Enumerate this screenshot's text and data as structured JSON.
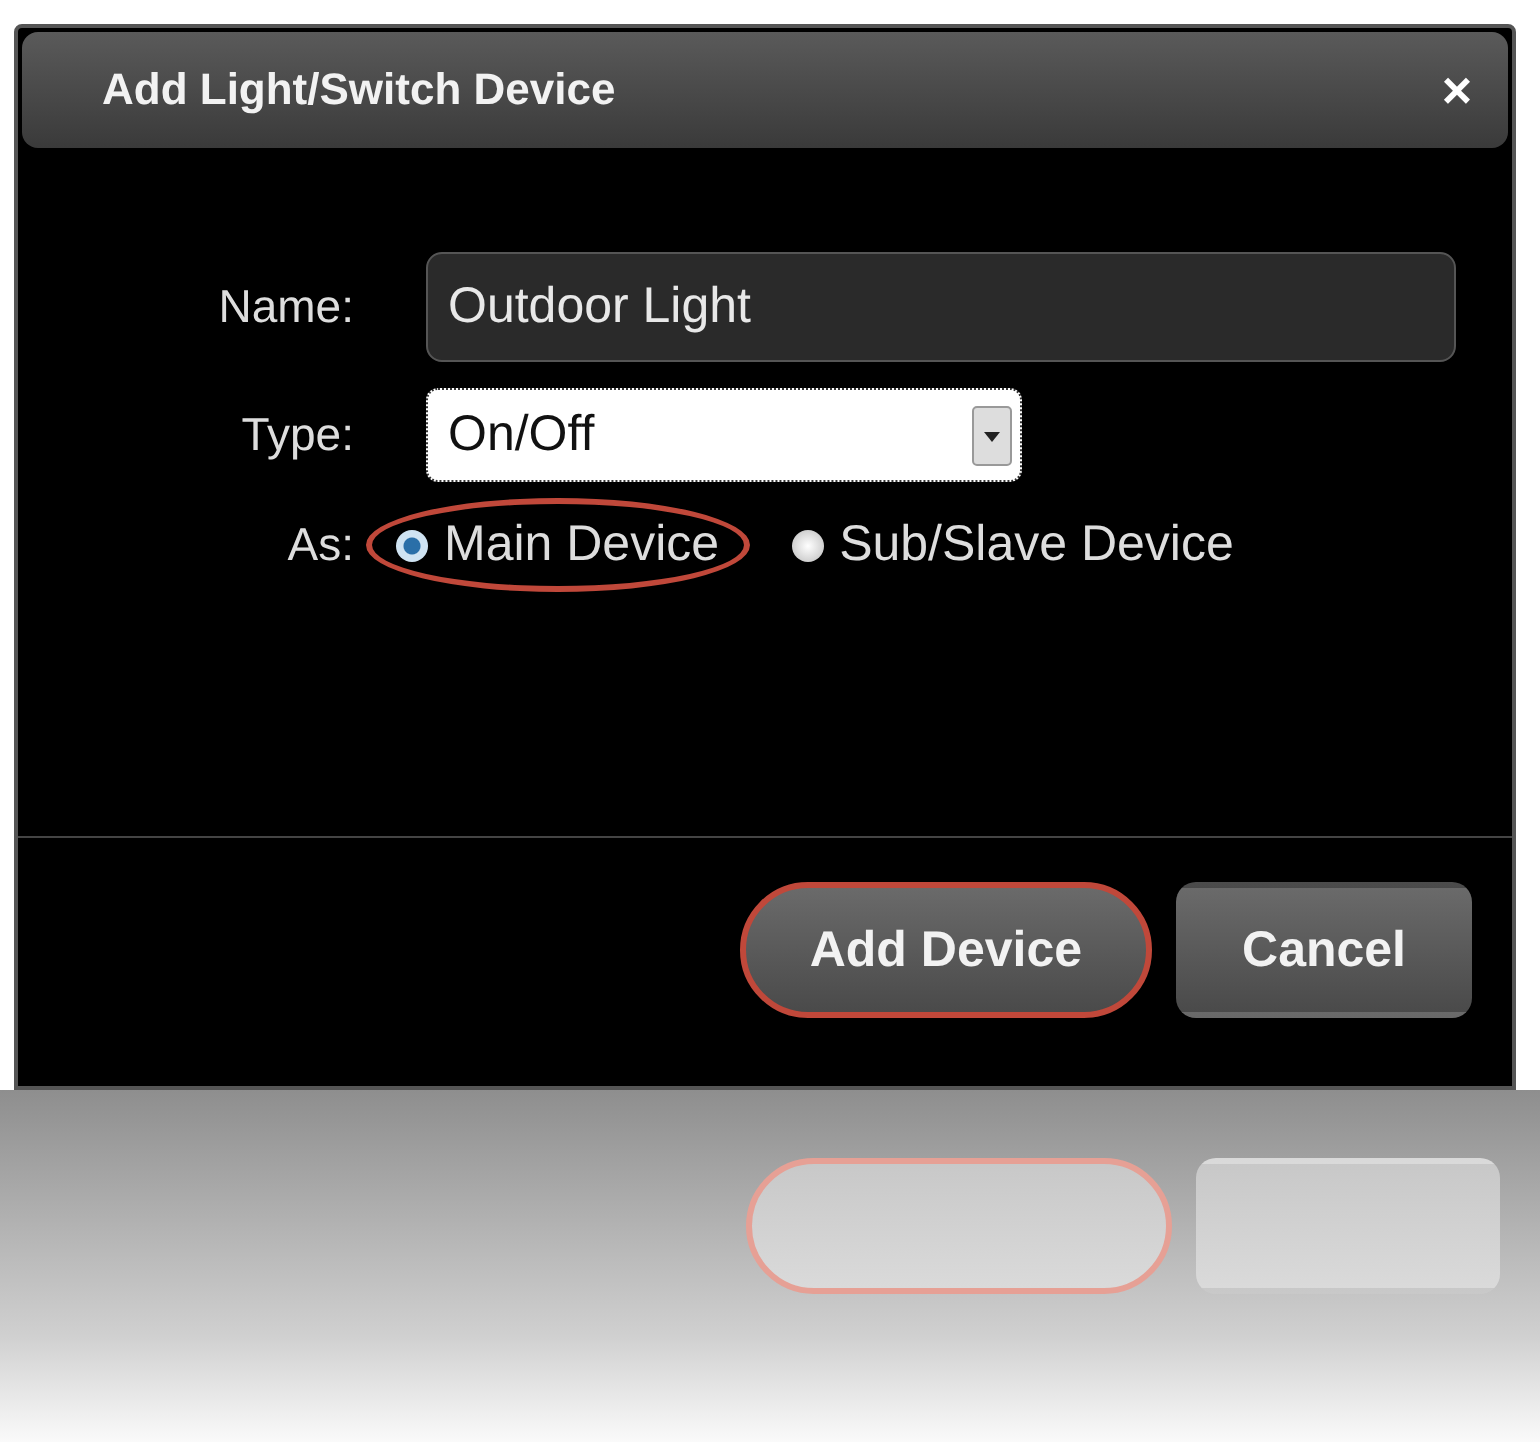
{
  "window": {
    "title": "Add Light/Switch Device",
    "close": "×"
  },
  "form": {
    "name": {
      "label": "Name:",
      "value": "Outdoor Light"
    },
    "type": {
      "label": "Type:",
      "value": "On/Off"
    },
    "as": {
      "label": "As:",
      "options": [
        {
          "label": "Main Device",
          "selected": true,
          "highlighted": true
        },
        {
          "label": "Sub/Slave Device",
          "selected": false,
          "highlighted": false
        }
      ]
    }
  },
  "buttons": [
    {
      "label": "Add Device",
      "highlighted": true
    },
    {
      "label": "Cancel",
      "highlighted": false
    }
  ],
  "reflection": {
    "buttons": [
      {
        "highlighted": true
      },
      {
        "highlighted": false
      }
    ]
  }
}
